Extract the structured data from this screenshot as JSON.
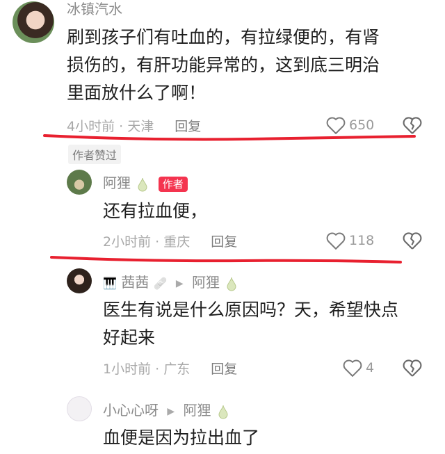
{
  "comments": [
    {
      "username": "冰镇汽水",
      "text_lines": [
        "刷到孩子们有吐血的，有拉绿便的，有肾",
        "损伤的，有肝功能异常的，这到底三明治",
        "里面放什么了啊！"
      ],
      "time": "4小时前",
      "location": "天津",
      "reply_label": "回复",
      "likes": "650",
      "liked_tag": "作者赞过"
    },
    {
      "username": "阿狸",
      "badge": "作者",
      "text": "还有拉血便，",
      "time": "2小时前",
      "location": "重庆",
      "reply_label": "回复",
      "likes": "118"
    },
    {
      "username": "茜茜",
      "reply_to": "阿狸",
      "text_lines": [
        "医生有说是什么原因吗？天，希望快点",
        "好起来"
      ],
      "time": "1小时前",
      "location": "广东",
      "reply_label": "回复",
      "likes": "4"
    },
    {
      "username": "小心心呀",
      "reply_to": "阿狸",
      "text": "血便是因为拉出血了"
    }
  ],
  "colors": {
    "annotation_underline": "#e8202f",
    "author_badge": "#f4344f",
    "meta_gray": "#a8a8a8"
  },
  "icons": [
    "heart-outline-icon",
    "broken-heart-icon",
    "reply-arrow-icon",
    "drop-pendant-icon"
  ]
}
